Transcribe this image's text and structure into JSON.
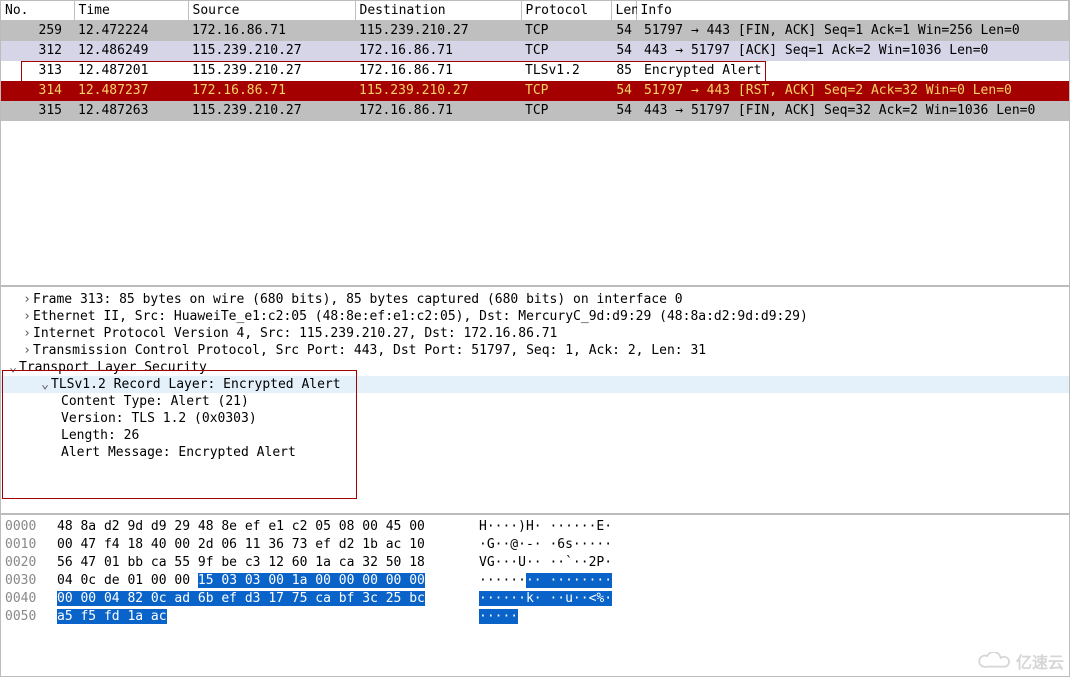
{
  "columns": {
    "no": "No.",
    "time": "Time",
    "source": "Source",
    "destination": "Destination",
    "protocol": "Protocol",
    "length": "Length",
    "info": "Info"
  },
  "packets": [
    {
      "no": "259",
      "time": "12.472224",
      "src": "172.16.86.71",
      "dst": "115.239.210.27",
      "proto": "TCP",
      "len": "54",
      "info": "51797 → 443 [FIN, ACK] Seq=1 Ack=1 Win=256 Len=0",
      "rowClass": "gray"
    },
    {
      "no": "312",
      "time": "12.486249",
      "src": "115.239.210.27",
      "dst": "172.16.86.71",
      "proto": "TCP",
      "len": "54",
      "info": "443 → 51797 [ACK] Seq=1 Ack=2 Win=1036 Len=0",
      "rowClass": "grayblue"
    },
    {
      "no": "313",
      "time": "12.487201",
      "src": "115.239.210.27",
      "dst": "172.16.86.71",
      "proto": "TLSv1.2",
      "len": "85",
      "info": "Encrypted Alert",
      "rowClass": "white"
    },
    {
      "no": "314",
      "time": "12.487237",
      "src": "172.16.86.71",
      "dst": "115.239.210.27",
      "proto": "TCP",
      "len": "54",
      "info": "51797 → 443 [RST, ACK] Seq=2 Ack=32 Win=0 Len=0",
      "rowClass": "red"
    },
    {
      "no": "315",
      "time": "12.487263",
      "src": "115.239.210.27",
      "dst": "172.16.86.71",
      "proto": "TCP",
      "len": "54",
      "info": "443 → 51797 [FIN, ACK] Seq=32 Ack=2 Win=1036 Len=0",
      "rowClass": "gray"
    }
  ],
  "details": {
    "frame": "Frame 313: 85 bytes on wire (680 bits), 85 bytes captured (680 bits) on interface 0",
    "eth": "Ethernet II, Src: HuaweiTe_e1:c2:05 (48:8e:ef:e1:c2:05), Dst: MercuryC_9d:d9:29 (48:8a:d2:9d:d9:29)",
    "ip": "Internet Protocol Version 4, Src: 115.239.210.27, Dst: 172.16.86.71",
    "tcp": "Transmission Control Protocol, Src Port: 443, Dst Port: 51797, Seq: 1, Ack: 2, Len: 31",
    "tls": "Transport Layer Security",
    "record": "TLSv1.2 Record Layer: Encrypted Alert",
    "ctype": "Content Type: Alert (21)",
    "version": "Version: TLS 1.2 (0x0303)",
    "length": "Length: 26",
    "alert": "Alert Message: Encrypted Alert"
  },
  "hex": {
    "rows": [
      {
        "off": "0000",
        "p1": "48 8a d2 9d d9 29 48 8e  ef e1 c2 05 08 00 45 00",
        "a1": "H····)H· ······E·",
        "sel": "none"
      },
      {
        "off": "0010",
        "p1": "00 47 f4 18 40 00 2d 06  11 36 73 ef d2 1b ac 10",
        "a1": "·G··@·-· ·6s·····",
        "sel": "none"
      },
      {
        "off": "0020",
        "p1": "56 47 01 bb ca 55 9f be  c3 12 60 1a ca 32 50 18",
        "a1": "VG···U·· ··`··2P·",
        "sel": "none"
      },
      {
        "off": "0030",
        "p1": "04 0c de 01 00 00 ",
        "p1sel": "15 03  03 00 1a 00 00 00 00 00",
        "a1": "······",
        "a1sel": "·· ········",
        "sel": "partial"
      },
      {
        "off": "0040",
        "p1sel": "00 00 04 82 0c ad 6b ef  d3 17 75 ca bf 3c 25 bc",
        "a1sel": "······k· ··u··<%·",
        "sel": "full"
      },
      {
        "off": "0050",
        "p1sel": "a5 f5 fd 1a ac",
        "a1sel": "·····",
        "sel": "full"
      }
    ]
  },
  "watermark": "亿速云"
}
